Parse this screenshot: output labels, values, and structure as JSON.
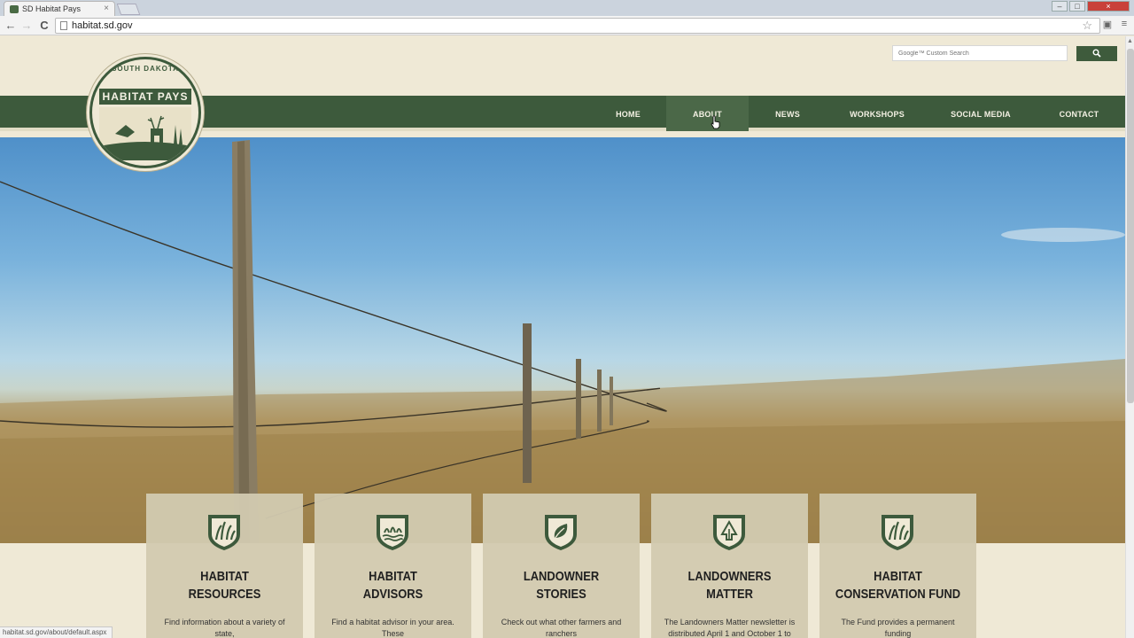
{
  "browser": {
    "tab_title": "SD Habitat Pays",
    "tab_close": "×",
    "url": "habitat.sd.gov",
    "back": "←",
    "forward": "→",
    "reload": "C",
    "star": "☆",
    "status_url": "habitat.sd.gov/about/default.aspx",
    "minimize": "–",
    "maximize": "□",
    "close": "×"
  },
  "search": {
    "placeholder": "Google™ Custom Search",
    "button_icon": "search-icon"
  },
  "logo": {
    "top_text": "SOUTH DAKOTA",
    "banner_text": "HABITAT PAYS"
  },
  "nav": {
    "items": [
      {
        "label": "HOME"
      },
      {
        "label": "ABOUT"
      },
      {
        "label": "NEWS"
      },
      {
        "label": "WORKSHOPS"
      },
      {
        "label": "SOCIAL MEDIA"
      },
      {
        "label": "CONTACT"
      }
    ],
    "active": "ABOUT"
  },
  "cards": [
    {
      "title_line1": "HABITAT",
      "title_line2": "RESOURCES",
      "icon": "grass-icon",
      "desc": "Find information about a variety of state,"
    },
    {
      "title_line1": "HABITAT",
      "title_line2": "ADVISORS",
      "icon": "wetland-icon",
      "desc": "Find a habitat advisor in your area. These\n| help you assess habitat on"
    },
    {
      "title_line1": "LANDOWNER",
      "title_line2": "STORIES",
      "icon": "leaf-icon",
      "desc": "Check out what other farmers and ranchers\nare doing across South Dakota to improve"
    },
    {
      "title_line1": "LANDOWNERS",
      "title_line2": "MATTER",
      "icon": "tree-icon",
      "desc": "The Landowners Matter newsletter is\ndistributed April 1 and October 1 to"
    },
    {
      "title_line1": "HABITAT",
      "title_line2": "CONSERVATION FUND",
      "icon": "grass-icon",
      "desc": "The Fund provides a permanent funding\nsource for habitat work; learn about the"
    }
  ],
  "colors": {
    "primary_green": "#3d5a3c",
    "cream": "#efe9d6",
    "card_bg": "#d2cab0"
  }
}
